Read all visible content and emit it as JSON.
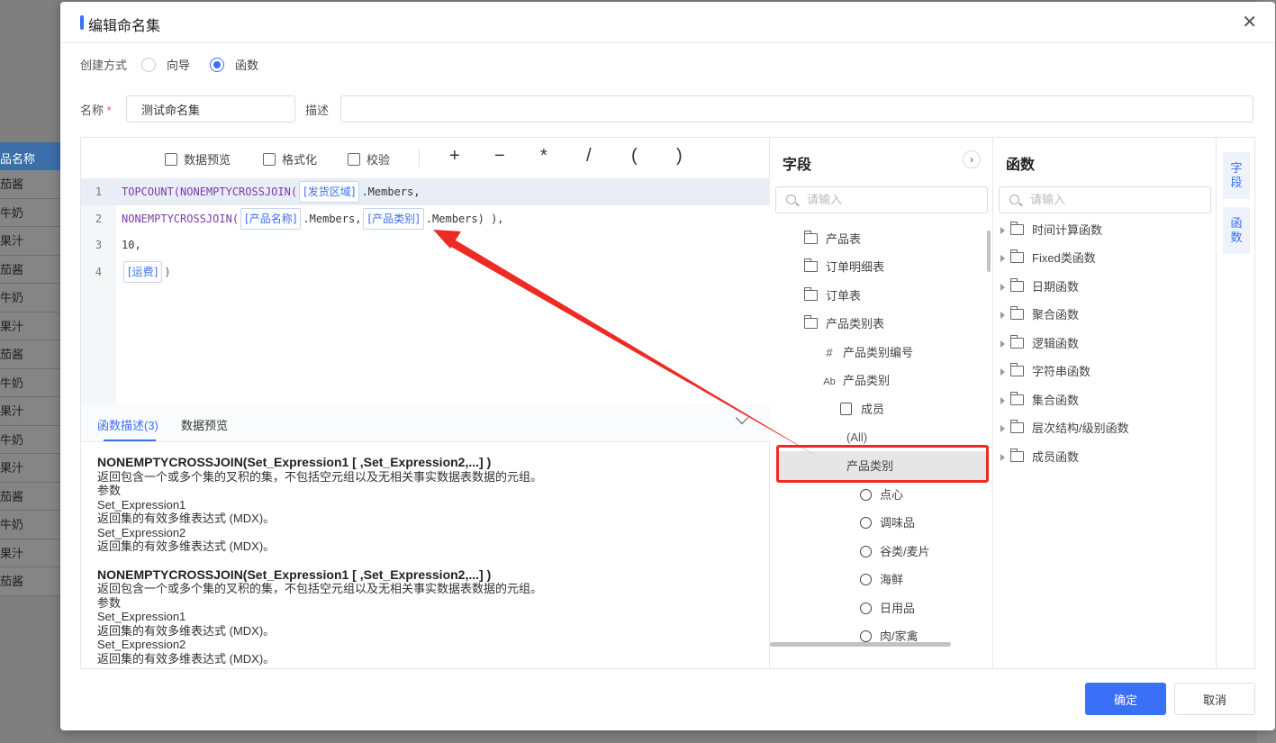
{
  "background": {
    "column_header": "品名称",
    "rows": [
      "茄酱",
      "牛奶",
      "果汁",
      "茄酱",
      "牛奶",
      "果汁",
      "茄酱",
      "牛奶",
      "果汁",
      "牛奶",
      "果汁",
      "茄酱",
      "牛奶",
      "果汁",
      "茄酱"
    ]
  },
  "dialog": {
    "title": "编辑命名集",
    "close_icon": "✕",
    "mode": {
      "label": "创建方式",
      "options": [
        "向导",
        "函数"
      ],
      "selected": "函数"
    },
    "name": {
      "label": "名称",
      "required_mark": "*",
      "value": "测试命名集"
    },
    "description": {
      "label": "描述",
      "value": ""
    },
    "toolbar": {
      "preview": "数据预览",
      "format": "格式化",
      "validate": "校验",
      "operators": [
        "+",
        "−",
        "*",
        "/",
        "(",
        ")"
      ]
    },
    "code": {
      "lines": [
        {
          "num": "1",
          "pre": "TOPCOUNT(NONEMPTYCROSSJOIN(",
          "tok1": "[发货区域]",
          "post": ".Members,"
        },
        {
          "num": "2",
          "pre": "NONEMPTYCROSSJOIN(",
          "tok1": "[产品名称]",
          "mid": ".Members,",
          "tok2": "[产品类别]",
          "post": ".Members) ),"
        },
        {
          "num": "3",
          "pre": "10,"
        },
        {
          "num": "4",
          "tok1": "[运费]",
          "post": ")"
        }
      ]
    },
    "desc_tabs": {
      "tab1": "函数描述(3)",
      "tab2": "数据预览"
    },
    "descriptions": [
      {
        "signature": "NONEMPTYCROSSJOIN(Set_Expression1 [ ,Set_Expression2,...] )",
        "summary": "返回包含一个或多个集的叉积的集，不包括空元组以及无相关事实数据表数据的元组。",
        "params_label": "参数",
        "p1": "Set_Expression1",
        "p1_desc": "返回集的有效多维表达式 (MDX)。",
        "p2": "Set_Expression2",
        "p2_desc": "返回集的有效多维表达式 (MDX)。"
      },
      {
        "signature": "NONEMPTYCROSSJOIN(Set_Expression1 [ ,Set_Expression2,...] )",
        "summary": "返回包含一个或多个集的叉积的集，不包括空元组以及无相关事实数据表数据的元组。",
        "params_label": "参数",
        "p1": "Set_Expression1",
        "p1_desc": "返回集的有效多维表达式 (MDX)。",
        "p2": "Set_Expression2",
        "p2_desc": "返回集的有效多维表达式 (MDX)。"
      }
    ],
    "fields_panel": {
      "title": "字段",
      "expand_icon": "›",
      "search_placeholder": "请输入",
      "tables": [
        "产品表",
        "订单明细表",
        "订单表",
        "产品类别表"
      ],
      "columns": [
        {
          "icon": "#",
          "label": "产品类别编号"
        },
        {
          "icon": "Ab",
          "label": "产品类别"
        }
      ],
      "members_label": "成员",
      "all_label": "(All)",
      "selected_level": "产品类别",
      "members": [
        "点心",
        "调味品",
        "谷类/麦片",
        "海鲜",
        "日用品",
        "肉/家禽"
      ]
    },
    "functions_panel": {
      "title": "函数",
      "search_placeholder": "请输入",
      "groups": [
        "时间计算函数",
        "Fixed类函数",
        "日期函数",
        "聚合函数",
        "逻辑函数",
        "字符串函数",
        "集合函数",
        "层次结构/级别函数",
        "成员函数"
      ]
    },
    "side_tabs": {
      "fields": "字\n段",
      "functions": "函\n数"
    },
    "buttons": {
      "ok": "确定",
      "cancel": "取消"
    }
  },
  "colors": {
    "accent": "#3a6ff7",
    "highlight": "#ee2a24"
  }
}
